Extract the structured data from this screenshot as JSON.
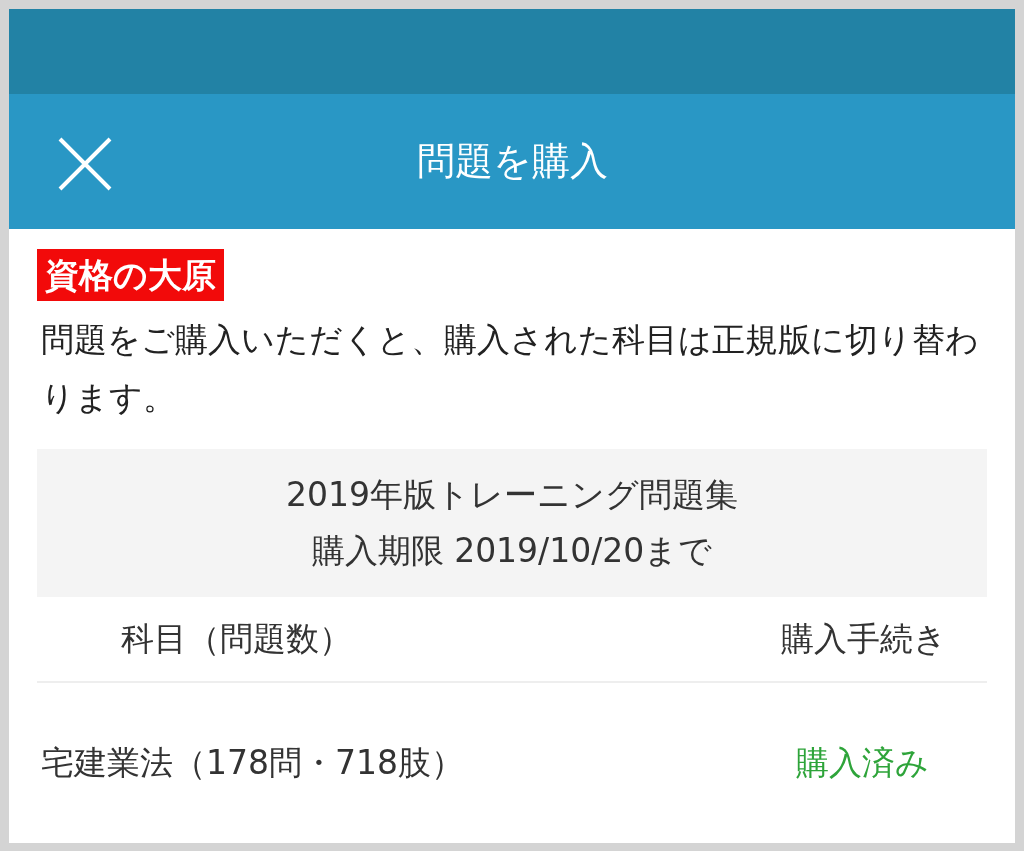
{
  "header": {
    "title": "問題を購入"
  },
  "logo": {
    "text": "資格の大原"
  },
  "intro": "問題をご購入いただくと、購入された科目は正規版に切り替わります。",
  "info": {
    "lines": [
      "2019年版トレーニング問題集",
      "購入期限 2019/10/20まで"
    ]
  },
  "table": {
    "columns": [
      "科目（問題数）",
      "購入手続き"
    ],
    "rows": [
      {
        "subject": "宅建業法（178問・718肢）",
        "status": "購入済み",
        "kind": "purchased"
      }
    ]
  }
}
